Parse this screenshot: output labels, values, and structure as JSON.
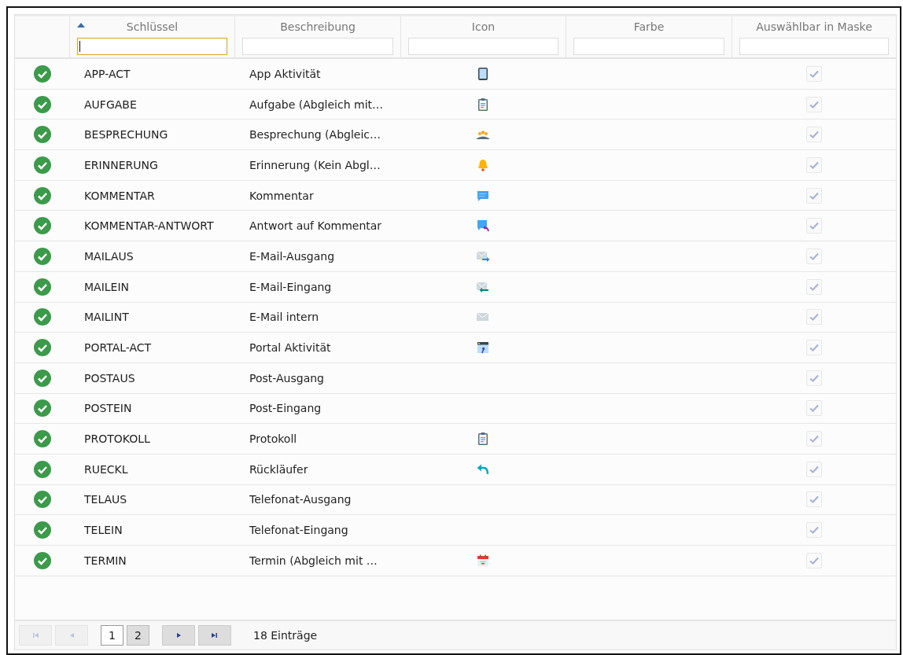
{
  "columns": [
    {
      "label": "Schlüssel",
      "sorted": true,
      "filter_focused": true
    },
    {
      "label": "Beschreibung",
      "sorted": false,
      "filter_focused": false
    },
    {
      "label": "Icon",
      "sorted": false,
      "filter_focused": false
    },
    {
      "label": "Farbe",
      "sorted": false,
      "filter_focused": false
    },
    {
      "label": "Auswählbar in Maske",
      "sorted": false,
      "filter_focused": false
    }
  ],
  "rows": [
    {
      "active": true,
      "key": "APP-ACT",
      "description": "App Aktivität",
      "kind": "tablet",
      "selectable": true
    },
    {
      "active": true,
      "key": "AUFGABE",
      "description": "Aufgabe (Abgleich mit…",
      "kind": "clipboard",
      "selectable": true
    },
    {
      "active": true,
      "key": "BESPRECHUNG",
      "description": "Besprechung (Abgleic…",
      "kind": "group",
      "selectable": true
    },
    {
      "active": true,
      "key": "ERINNERUNG",
      "description": "Erinnerung (Kein Abgl…",
      "kind": "bell",
      "selectable": true
    },
    {
      "active": true,
      "key": "KOMMENTAR",
      "description": "Kommentar",
      "kind": "comment",
      "selectable": true
    },
    {
      "active": true,
      "key": "KOMMENTAR-ANTWORT",
      "description": "Antwort auf Kommentar",
      "kind": "comment-reply",
      "selectable": true
    },
    {
      "active": true,
      "key": "MAILAUS",
      "description": "E-Mail-Ausgang",
      "kind": "mail-out",
      "selectable": true
    },
    {
      "active": true,
      "key": "MAILEIN",
      "description": "E-Mail-Eingang",
      "kind": "mail-in",
      "selectable": true
    },
    {
      "active": true,
      "key": "MAILINT",
      "description": "E-Mail intern",
      "kind": "mail",
      "selectable": true
    },
    {
      "active": true,
      "key": "PORTAL-ACT",
      "description": "Portal Aktivität",
      "kind": "portal",
      "selectable": true
    },
    {
      "active": true,
      "key": "POSTAUS",
      "description": "Post-Ausgang",
      "kind": "none",
      "selectable": true
    },
    {
      "active": true,
      "key": "POSTEIN",
      "description": "Post-Eingang",
      "kind": "none",
      "selectable": true
    },
    {
      "active": true,
      "key": "PROTOKOLL",
      "description": "Protokoll",
      "kind": "clipboard",
      "selectable": true
    },
    {
      "active": true,
      "key": "RUECKL",
      "description": "Rückläufer",
      "kind": "reply",
      "selectable": true
    },
    {
      "active": true,
      "key": "TELAUS",
      "description": "Telefonat-Ausgang",
      "kind": "none",
      "selectable": true
    },
    {
      "active": true,
      "key": "TELEIN",
      "description": "Telefonat-Eingang",
      "kind": "none",
      "selectable": true
    },
    {
      "active": true,
      "key": "TERMIN",
      "description": "Termin (Abgleich mit …",
      "kind": "calendar",
      "selectable": true
    }
  ],
  "pager": {
    "first_disabled": true,
    "prev_disabled": true,
    "next_disabled": false,
    "last_disabled": false,
    "pages": [
      {
        "label": "1",
        "selected": true
      },
      {
        "label": "2",
        "selected": false
      }
    ],
    "count": "18 Einträge"
  }
}
